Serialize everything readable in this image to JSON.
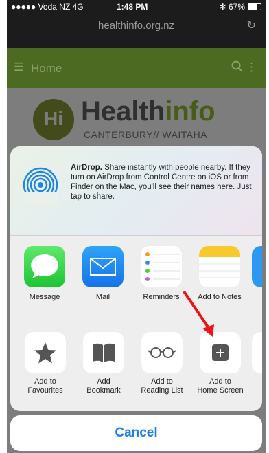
{
  "status_bar": {
    "carrier": "●●●●● Voda NZ  4G",
    "time": "1:48 PM",
    "battery": "67%"
  },
  "browser": {
    "url": "healthinfo.org.nz",
    "reload_icon": "reload-icon"
  },
  "site_nav": {
    "title": "Home",
    "menu_icon": "hamburger-icon",
    "search_icon": "search-icon",
    "more_icon": "more-icon"
  },
  "page": {
    "logo_mark": "Hi",
    "logo_name_dark": "Health",
    "logo_name_green": "info",
    "logo_sub": "CANTERBURY// WAITAHA"
  },
  "share_sheet": {
    "airdrop": {
      "title": "AirDrop.",
      "text": " Share instantly with people nearby. If they turn on AirDrop from Control Centre on iOS or from Finder on the Mac, you'll see their names here. Just tap to share."
    },
    "apps": [
      {
        "label": "Message",
        "icon": "message-icon"
      },
      {
        "label": "Mail",
        "icon": "mail-icon"
      },
      {
        "label": "Reminders",
        "icon": "reminders-icon"
      },
      {
        "label": "Add to Notes",
        "icon": "notes-icon"
      }
    ],
    "actions": [
      {
        "label_line1": "Add to",
        "label_line2": "Favourites",
        "icon": "star-icon"
      },
      {
        "label_line1": "Add",
        "label_line2": "Bookmark",
        "icon": "book-icon"
      },
      {
        "label_line1": "Add to",
        "label_line2": "Reading List",
        "icon": "glasses-icon"
      },
      {
        "label_line1": "Add to",
        "label_line2": "Home Screen",
        "icon": "plus-square-icon"
      }
    ],
    "cancel": "Cancel"
  },
  "annotation": {
    "arrow_color": "#e8161b"
  }
}
